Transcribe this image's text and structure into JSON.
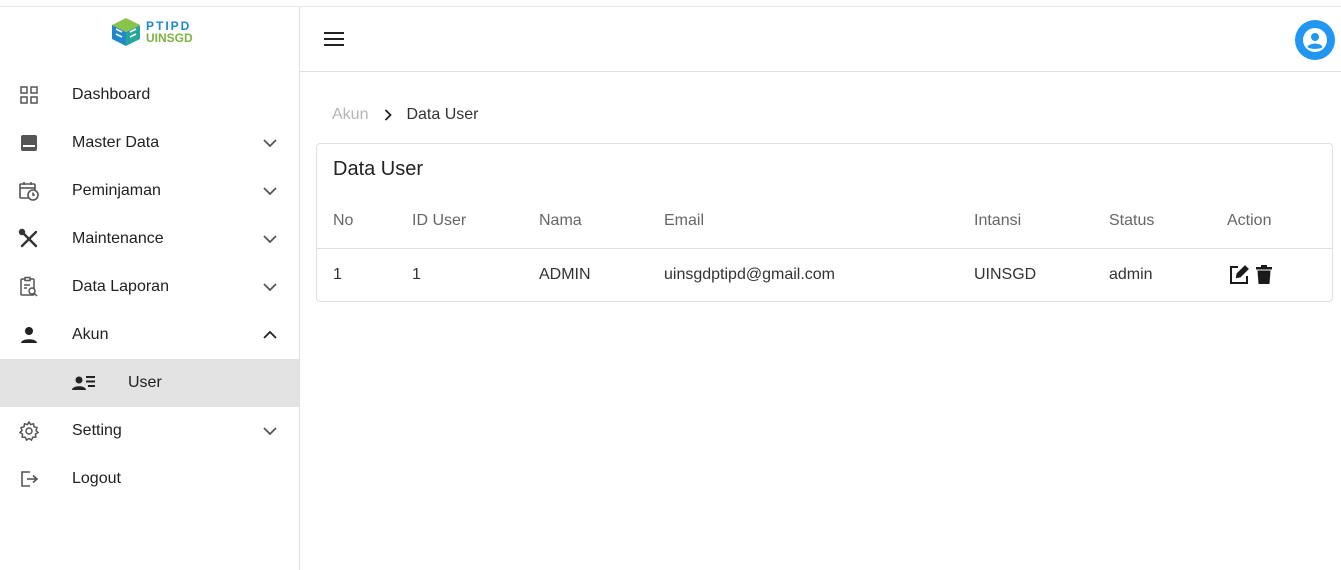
{
  "logo": {
    "line1": "PTIPD",
    "line2": "UINSGD"
  },
  "sidebar": {
    "items": [
      {
        "label": "Dashboard",
        "icon": "grid-icon"
      },
      {
        "label": "Master Data",
        "icon": "archive-icon",
        "expandable": true
      },
      {
        "label": "Peminjaman",
        "icon": "calendar-clock-icon",
        "expandable": true
      },
      {
        "label": "Maintenance",
        "icon": "tools-icon",
        "expandable": true
      },
      {
        "label": "Data Laporan",
        "icon": "clipboard-search-icon",
        "expandable": true
      },
      {
        "label": "Akun",
        "icon": "person-icon",
        "expanded": true
      },
      {
        "label": "User",
        "icon": "person-list-icon",
        "active": true
      },
      {
        "label": "Setting",
        "icon": "gear-icon",
        "expandable": true
      },
      {
        "label": "Logout",
        "icon": "logout-icon"
      }
    ]
  },
  "header": {
    "menu_icon": "menu-icon",
    "avatar_icon": "account-circle-icon",
    "avatar_color": "#2196f3"
  },
  "breadcrumb": {
    "parent": "Akun",
    "current": "Data User"
  },
  "card": {
    "title": "Data User",
    "columns": [
      "No",
      "ID User",
      "Nama",
      "Email",
      "Intansi",
      "Status",
      "Action"
    ],
    "rows": [
      {
        "no": "1",
        "id_user": "1",
        "nama": "ADMIN",
        "email": "uinsgdptipd@gmail.com",
        "intansi": "UINSGD",
        "status": "admin"
      }
    ]
  }
}
